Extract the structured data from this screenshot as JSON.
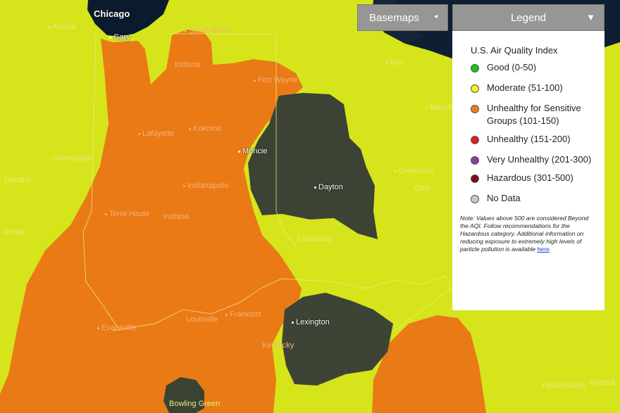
{
  "map": {
    "colors": {
      "moderate": "#d6e51b",
      "unhealthy_sensitive": "#ea7a15",
      "satellite": "#3c4234",
      "water": "#0b1b2e"
    },
    "cities": [
      {
        "name": "Chicago",
        "style": "white bold"
      },
      {
        "name": "Aurora",
        "style": "light"
      },
      {
        "name": "Gary",
        "style": "white"
      },
      {
        "name": "South Bend",
        "style": "onorange"
      },
      {
        "name": "Indiana",
        "style": "onorange"
      },
      {
        "name": "Fort Wayne",
        "style": "onorange"
      },
      {
        "name": "Lafayette",
        "style": "onorange"
      },
      {
        "name": "Kokomo",
        "style": "onorange"
      },
      {
        "name": "Muncie",
        "style": "white"
      },
      {
        "name": "Champaign",
        "style": "light"
      },
      {
        "name": "Indianapolis",
        "style": "onorange"
      },
      {
        "name": "Decatur",
        "style": "light"
      },
      {
        "name": "Terre Haute",
        "style": "onorange"
      },
      {
        "name": "Indiana",
        "style": "onorange"
      },
      {
        "name": "Illinois",
        "style": "light"
      },
      {
        "name": "Dayton",
        "style": "white"
      },
      {
        "name": "Columbus",
        "style": "light"
      },
      {
        "name": "Ohio",
        "style": "light"
      },
      {
        "name": "Ohio",
        "style": "light"
      },
      {
        "name": "Mansfi",
        "style": "light"
      },
      {
        "name": "Cincinnati",
        "style": "light"
      },
      {
        "name": "Evansville",
        "style": "onorange"
      },
      {
        "name": "Louisville",
        "style": "onorange"
      },
      {
        "name": "Frankfort",
        "style": "onorange"
      },
      {
        "name": "Lexington",
        "style": "white"
      },
      {
        "name": "Kentucky",
        "style": "onorange"
      },
      {
        "name": "Bowling Green",
        "style": "light"
      },
      {
        "name": "Blacksburg",
        "style": "light"
      },
      {
        "name": "Roanok",
        "style": "light"
      }
    ]
  },
  "controls": {
    "basemaps_label": "Basemaps",
    "basemaps_arrow": "◂",
    "legend_label": "Legend",
    "legend_arrow": "▼"
  },
  "legend": {
    "title": "U.S. Air Quality Index",
    "items": [
      {
        "label": "Good (0-50)",
        "color": "#18c418"
      },
      {
        "label": "Moderate (51-100)",
        "color": "#f2ef1c"
      },
      {
        "label": "Unhealthy for Sensitive Groups (101-150)",
        "color": "#ee7d1c"
      },
      {
        "label": "Unhealthy (151-200)",
        "color": "#e41a1c"
      },
      {
        "label": "Very Unhealthy (201-300)",
        "color": "#8e3d9c"
      },
      {
        "label": "Hazardous (301-500)",
        "color": "#7d0a1c"
      },
      {
        "label": "No Data",
        "color": "#c8c8c8"
      }
    ],
    "note": "Note: Values above 500 are considered Beyond the AQI. Follow recommendations for the Hazardous category. Additional information on reducing exposure to extremely high levels of particle pollution is available",
    "note_link": "here",
    "note_end": "."
  }
}
